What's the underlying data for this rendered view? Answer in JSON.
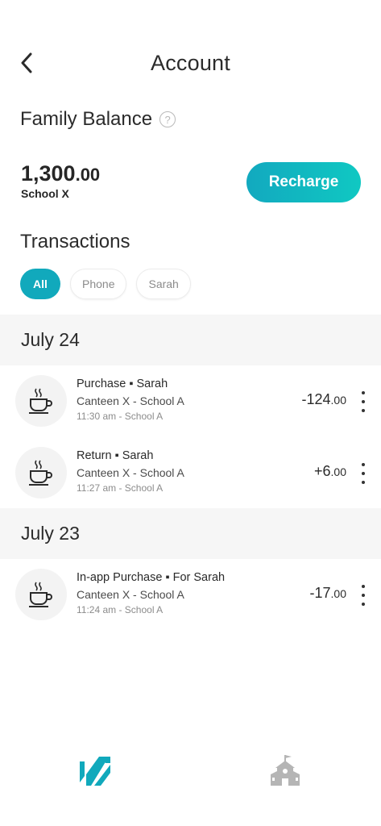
{
  "header": {
    "title": "Account",
    "back_icon": "chevron-left-icon"
  },
  "balance": {
    "title": "Family Balance",
    "help_icon": "?",
    "amount_whole": "1,300",
    "amount_decimal": ".00",
    "school": "School X",
    "recharge_label": "Recharge"
  },
  "transactions": {
    "title": "Transactions",
    "filters": [
      {
        "label": "All",
        "active": true
      },
      {
        "label": "Phone",
        "active": false
      },
      {
        "label": "Sarah",
        "active": false
      }
    ]
  },
  "groups": [
    {
      "date": "July 24",
      "items": [
        {
          "line1": "Purchase ▪ Sarah",
          "line2": "Canteen X - School A",
          "line3": "11:30 am - School A",
          "amount_whole": "-124",
          "amount_decimal": ".00",
          "icon": "coffee-cup-icon"
        },
        {
          "line1": "Return ▪ Sarah",
          "line2": "Canteen X - School A",
          "line3": "11:27 am - School A",
          "amount_whole": "+6",
          "amount_decimal": ".00",
          "icon": "coffee-cup-icon"
        }
      ]
    },
    {
      "date": "July 23",
      "items": [
        {
          "line1": "In-app Purchase ▪ For Sarah",
          "line2": "Canteen X - School A",
          "line3": "11:24 am - School A",
          "amount_whole": "-17",
          "amount_decimal": ".00",
          "icon": "coffee-cup-icon"
        }
      ]
    }
  ],
  "nav": {
    "home_icon": "brand-logo-icon",
    "school_icon": "school-building-icon"
  },
  "colors": {
    "accent": "#11a9bc",
    "accent_light": "#10c8c2",
    "band": "#f6f6f6",
    "inactive_icon": "#b5b5b5"
  }
}
